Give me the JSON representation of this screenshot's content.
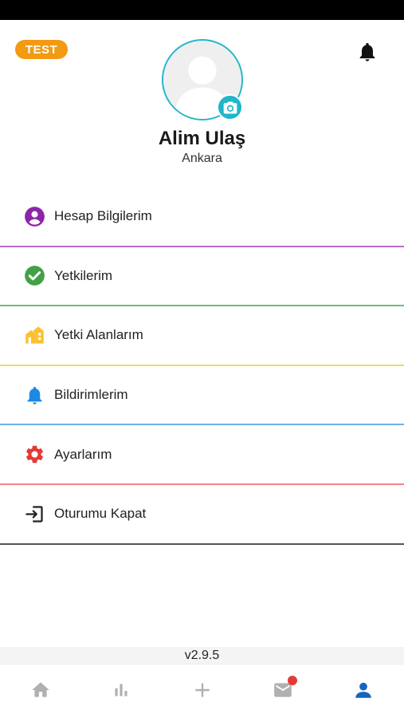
{
  "header": {
    "env_badge": "TEST"
  },
  "profile": {
    "name": "Alim Ulaş",
    "city": "Ankara"
  },
  "menu": {
    "items": [
      {
        "label": "Hesap Bilgilerim",
        "icon": "account-circle-icon",
        "color": "#8e24aa"
      },
      {
        "label": "Yetkilerim",
        "icon": "check-circle-icon",
        "color": "#43a047"
      },
      {
        "label": "Yetki Alanlarım",
        "icon": "houses-icon",
        "color": "#fbc02d"
      },
      {
        "label": "Bildirimlerim",
        "icon": "bell-icon",
        "color": "#1e88e5"
      },
      {
        "label": "Ayarlarım",
        "icon": "gear-icon",
        "color": "#e53935"
      },
      {
        "label": "Oturumu Kapat",
        "icon": "logout-icon",
        "color": "#222222"
      }
    ]
  },
  "footer": {
    "version": "v2.9.5"
  },
  "bottom_nav": {
    "items": [
      "home-icon",
      "chart-icon",
      "plus-icon",
      "mail-icon",
      "profile-icon"
    ],
    "active": "profile-icon",
    "active_color": "#1565c0",
    "inactive_color": "#b0b0b0",
    "mail_has_notification": true
  },
  "colors": {
    "accent": "#1fb6c9",
    "badge": "#f39a12"
  }
}
